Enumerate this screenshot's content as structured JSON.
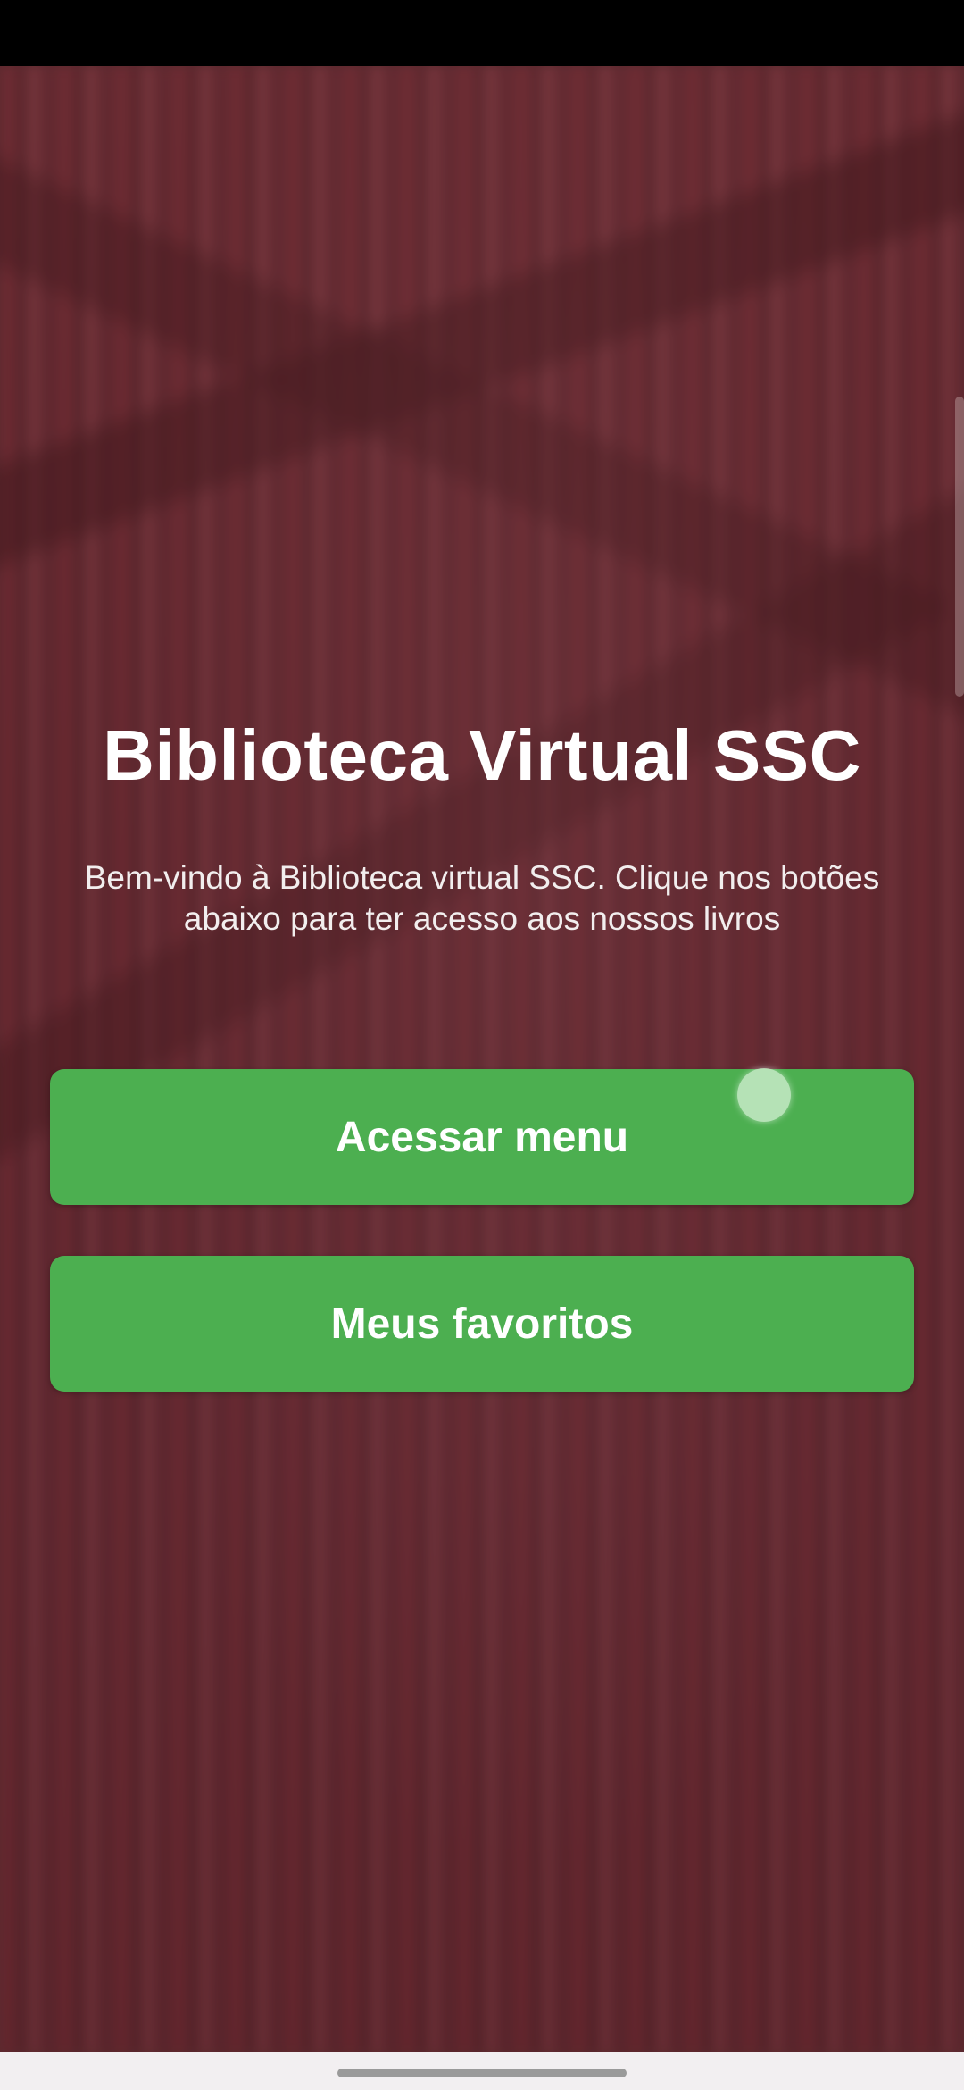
{
  "app": {
    "title": "Biblioteca Virtual SSC",
    "welcome_text": "Bem-vindo à Biblioteca virtual SSC. Clique nos botões abaixo para ter acesso aos nossos livros"
  },
  "buttons": {
    "menu_label": "Acessar menu",
    "favorites_label": "Meus favoritos"
  },
  "colors": {
    "button_green": "#4caf50",
    "text": "#ffffff",
    "background_tint": "#5a2a30"
  },
  "icons": {
    "background": "bookshelf-image"
  }
}
